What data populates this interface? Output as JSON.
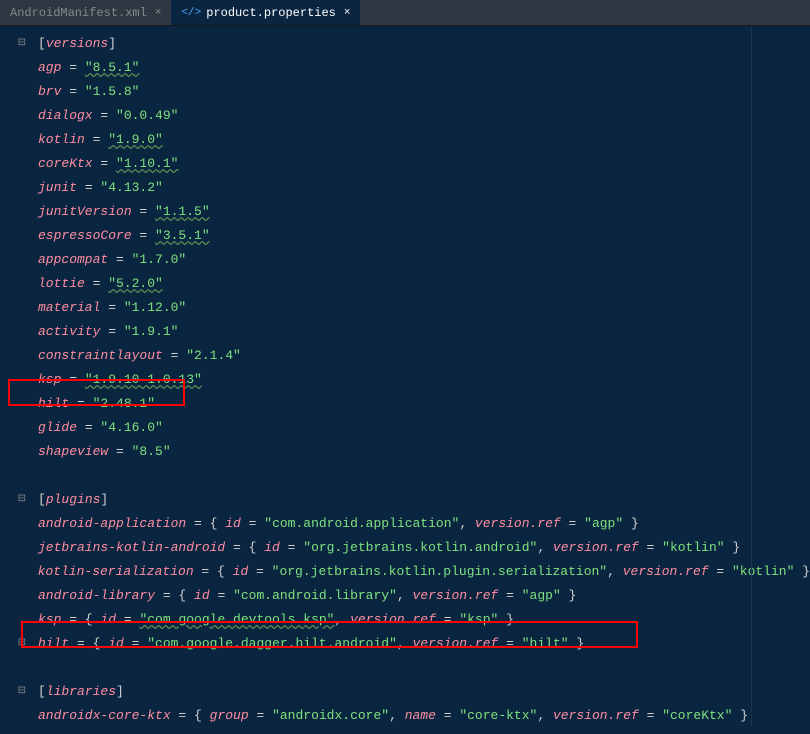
{
  "tabs": [
    {
      "label": "AndroidManifest.xml",
      "active": false
    },
    {
      "label": "product.properties",
      "active": true,
      "hasIcon": true
    }
  ],
  "versions": {
    "section": "versions",
    "entries": [
      {
        "key": "agp",
        "value": "\"8.5.1\"",
        "underline": true
      },
      {
        "key": "brv",
        "value": "\"1.5.8\""
      },
      {
        "key": "dialogx",
        "value": "\"0.0.49\""
      },
      {
        "key": "kotlin",
        "value": "\"1.9.0\"",
        "underline": true
      },
      {
        "key": "coreKtx",
        "value": "\"1.10.1\"",
        "underline": true
      },
      {
        "key": "junit",
        "value": "\"4.13.2\""
      },
      {
        "key": "junitVersion",
        "value": "\"1.1.5\"",
        "underline": true
      },
      {
        "key": "espressoCore",
        "value": "\"3.5.1\"",
        "underline": true
      },
      {
        "key": "appcompat",
        "value": "\"1.7.0\""
      },
      {
        "key": "lottie",
        "value": "\"5.2.0\"",
        "underline": true
      },
      {
        "key": "material",
        "value": "\"1.12.0\""
      },
      {
        "key": "activity",
        "value": "\"1.9.1\""
      },
      {
        "key": "constraintlayout",
        "value": "\"2.1.4\""
      },
      {
        "key": "ksp",
        "value": "\"1.9.10-1.0.13\"",
        "underline": true
      },
      {
        "key": "hilt",
        "value": "\"2.48.1\"",
        "highlight": true
      },
      {
        "key": "glide",
        "value": "\"4.16.0\""
      },
      {
        "key": "shapeview",
        "value": "\"8.5\""
      }
    ]
  },
  "plugins": {
    "section": "plugins",
    "entries": [
      {
        "key": "android-application",
        "id": "\"com.android.application\"",
        "ref": "\"agp\""
      },
      {
        "key": "jetbrains-kotlin-android",
        "id": "\"org.jetbrains.kotlin.android\"",
        "ref": "\"kotlin\""
      },
      {
        "key": "kotlin-serialization",
        "id": "\"org.jetbrains.kotlin.plugin.serialization\"",
        "ref": "\"kotlin\""
      },
      {
        "key": "android-library",
        "id": "\"com.android.library\"",
        "ref": "\"agp\""
      },
      {
        "key": "ksp",
        "id": "\"com.google.devtools.ksp\"",
        "ref": "\"ksp\"",
        "underline": true
      },
      {
        "key": "hilt",
        "id": "\"com.google.dagger.hilt.android\"",
        "ref": "\"hilt\"",
        "highlight": true
      }
    ]
  },
  "libraries": {
    "section": "libraries",
    "entries": [
      {
        "key": "androidx-core-ktx",
        "group": "\"androidx.core\"",
        "name": "\"core-ktx\"",
        "ref": "\"coreKtx\""
      }
    ]
  },
  "syntax": {
    "id_label": "id",
    "version_ref_label": "version.ref",
    "group_label": "group",
    "name_label": "name"
  }
}
